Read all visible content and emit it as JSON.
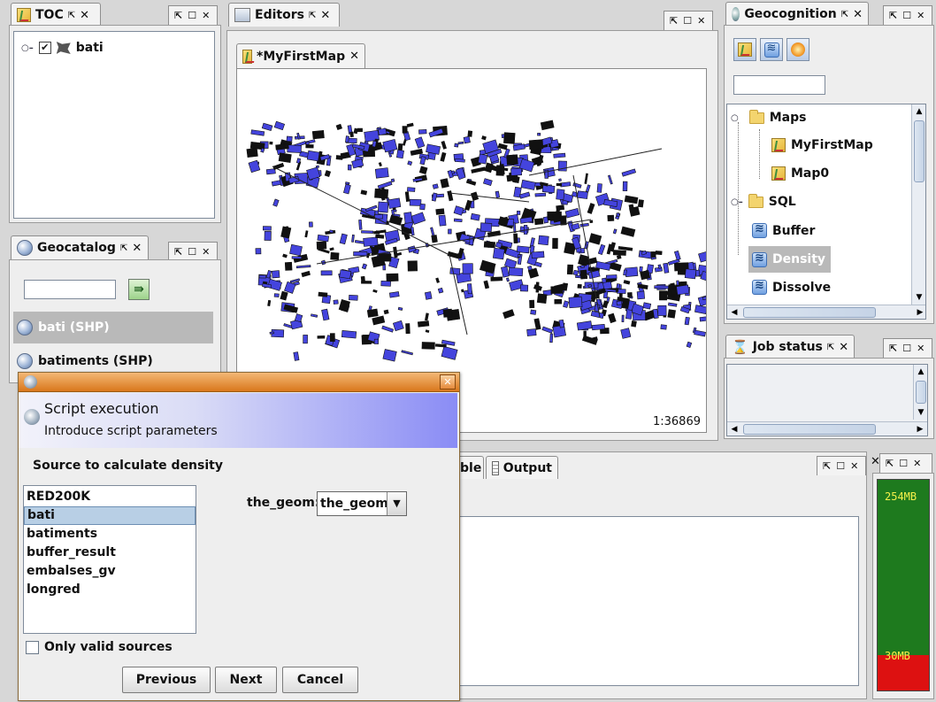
{
  "toc": {
    "title": "TOC",
    "layer_name": "bati"
  },
  "editors": {
    "title": "Editors",
    "map_tab": "*MyFirstMap",
    "scale": "1:36869"
  },
  "geocognition": {
    "title": "Geocognition",
    "search_value": "",
    "tree": [
      {
        "label": "Maps",
        "type": "folder"
      },
      {
        "label": "MyFirstMap",
        "type": "map"
      },
      {
        "label": "Map0",
        "type": "map"
      },
      {
        "label": "SQL",
        "type": "folder"
      },
      {
        "label": "Buffer",
        "type": "script"
      },
      {
        "label": "Density",
        "type": "script",
        "selected": true
      },
      {
        "label": "Dissolve",
        "type": "script"
      }
    ]
  },
  "geocatalog": {
    "title": "Geocatalog",
    "search_value": "",
    "items": [
      {
        "label": "bati (SHP)",
        "selected": true
      },
      {
        "label": "batiments (SHP)",
        "selected": false
      }
    ]
  },
  "job_status": {
    "title": "Job status"
  },
  "bottom_tabs": {
    "table_label": "ble",
    "output_label": "Output"
  },
  "memory": {
    "max_label": "254MB",
    "used_label": "30MB",
    "used_fraction": 0.17
  },
  "dialog": {
    "header_title": "Script execution",
    "header_subtitle": "Introduce script parameters",
    "source_label": "Source to calculate density",
    "sources": [
      "RED200K",
      "bati",
      "batiments",
      "buffer_result",
      "embalses_gv",
      "longred"
    ],
    "selected_source": "bati",
    "geom_label": "the_geom:",
    "geom_value": "the_geom",
    "only_valid_label": "Only valid sources",
    "only_valid_checked": false,
    "previous_label": "Previous",
    "next_label": "Next",
    "cancel_label": "Cancel"
  },
  "colors": {
    "building_fill": "#4444dd",
    "dialog_titlebar": "#e2892b",
    "dialog_header_gradient_end": "#8a8cf5",
    "memory_free": "#1e7a1e",
    "memory_used": "#dd1111"
  }
}
